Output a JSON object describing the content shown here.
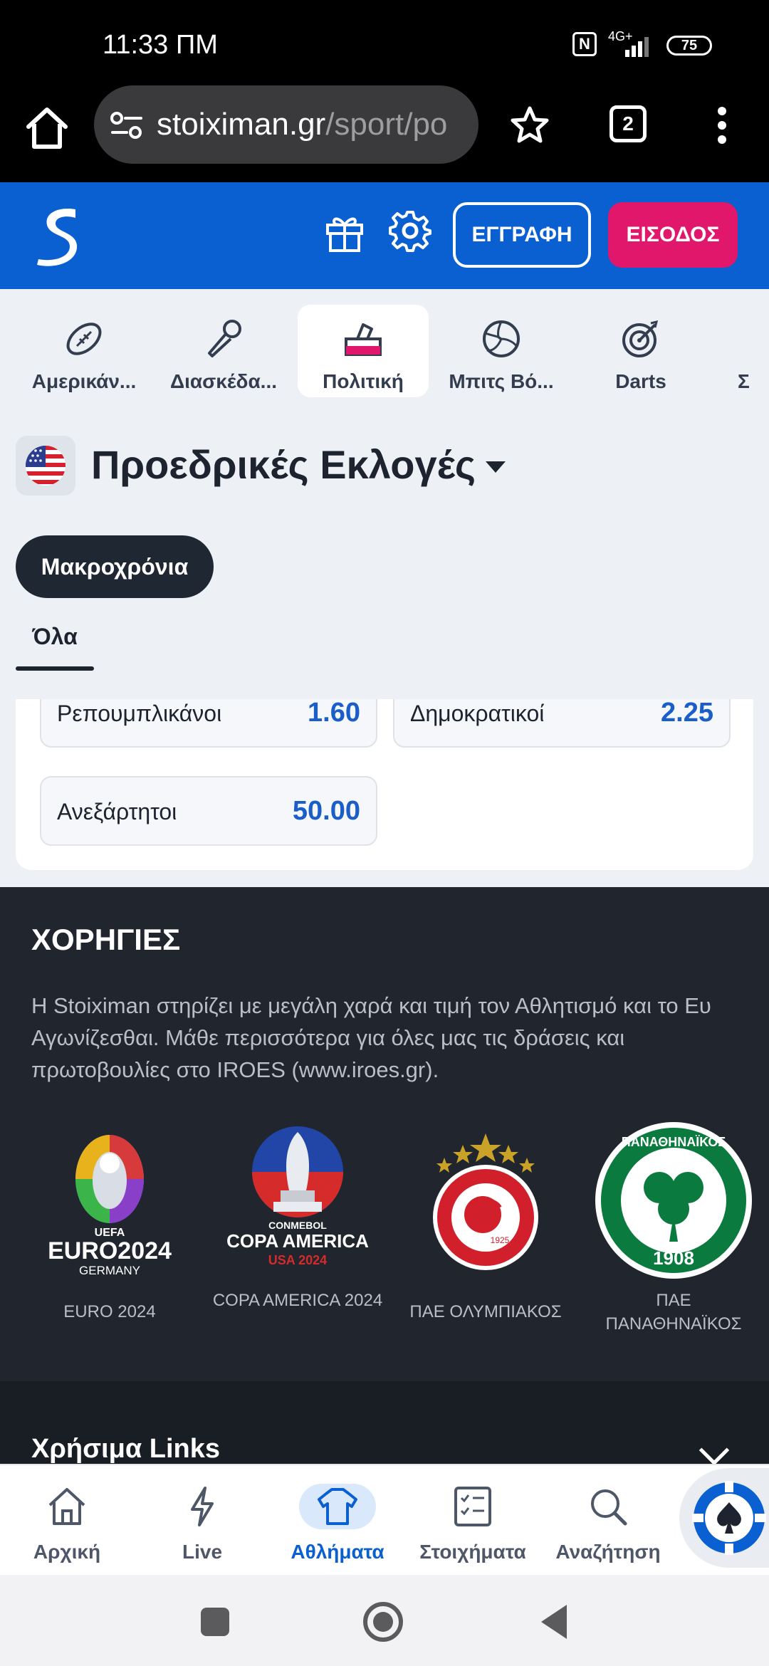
{
  "status_bar": {
    "time": "11:33 ΠΜ",
    "network": "4G+",
    "battery": "75"
  },
  "browser": {
    "url_host": "stoiximan.gr",
    "url_path": "/sport/po",
    "tab_count": "2"
  },
  "header": {
    "register_label": "ΕΓΓΡΑΦΗ",
    "login_label": "ΕΙΣΟΔΟΣ",
    "brand_color": "#0a5fd1",
    "login_color": "#e0176b"
  },
  "sports": [
    {
      "label": "Αμερικάν...",
      "icon": "american-football-icon"
    },
    {
      "label": "Διασκέδα...",
      "icon": "microphone-icon"
    },
    {
      "label": "Πολιτική",
      "icon": "ballot-box-icon",
      "active": true
    },
    {
      "label": "Μπιτς Βό...",
      "icon": "volleyball-icon"
    },
    {
      "label": "Darts",
      "icon": "dartboard-icon"
    },
    {
      "label": "Σ",
      "icon": "partial-sport-icon"
    }
  ],
  "league": {
    "title": "Προεδρικές Εκλογές",
    "flag": "usa-flag-icon"
  },
  "filter_pill": "Μακροχρόνια",
  "subtab": "Όλα",
  "market": {
    "odds": [
      {
        "name": "Ρεπουμπλικάνοι",
        "price": "1.60"
      },
      {
        "name": "Δημοκρατικοί",
        "price": "2.25"
      },
      {
        "name": "Ανεξάρτητοι",
        "price": "50.00"
      }
    ]
  },
  "sponsors": {
    "title": "ΧΟΡΗΓΙΕΣ",
    "description": "Η Stoiximan στηρίζει με μεγάλη χαρά και τιμή τον Αθλητισμό και το Ευ Αγωνίζεσθαι. Μάθε περισσότερα για όλες μας τις δράσεις και πρωτοβουλίες στο IROES (www.iroes.gr).",
    "items": [
      {
        "caption": "EURO 2024",
        "logo_text_1": "EURO2024",
        "logo_text_2": "GERMANY",
        "logo_text_3": "UEFA"
      },
      {
        "caption": "COPA AMERICA 2024",
        "logo_text_1": "COPA AMERICA",
        "logo_text_2": "USA 2024",
        "logo_text_3": "CONMEBOL"
      },
      {
        "caption": "ΠΑΕ ΟΛΥΜΠΙΑΚΟΣ",
        "logo_text_1": "1925"
      },
      {
        "caption": "ΠΑΕ ΠΑΝΑΘΗΝΑΪΚΟΣ",
        "logo_text_1": "1908",
        "logo_text_2": "ΠΑΝΑΘΗΝΑΪΚΟΣ"
      }
    ]
  },
  "links": {
    "title": "Χρήσιμα Links"
  },
  "bottom_nav": [
    {
      "label": "Αρχική",
      "icon": "home-icon"
    },
    {
      "label": "Live",
      "icon": "lightning-icon"
    },
    {
      "label": "Αθλήματα",
      "icon": "jersey-icon",
      "active": true
    },
    {
      "label": "Στοιχήματα",
      "icon": "betslip-icon"
    },
    {
      "label": "Αναζήτηση",
      "icon": "search-icon"
    }
  ]
}
